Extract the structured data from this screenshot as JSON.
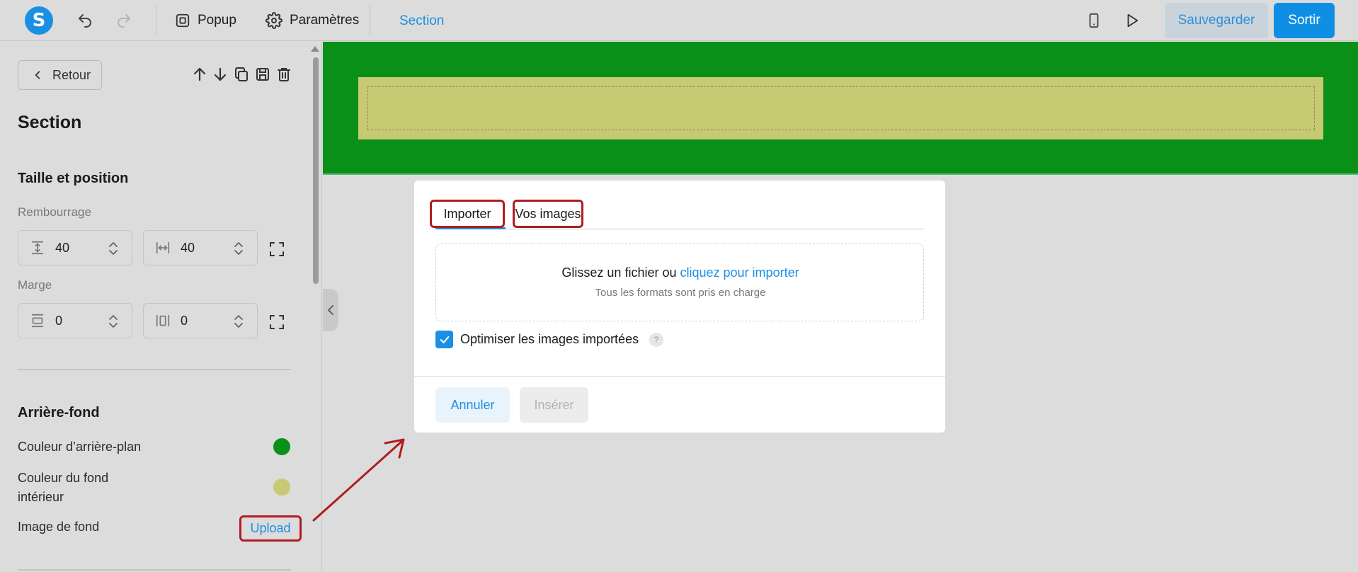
{
  "topbar": {
    "logo_letter": "S",
    "popup_label": "Popup",
    "settings_label": "Paramètres",
    "section_label": "Section",
    "save_label": "Sauvegarder",
    "exit_label": "Sortir",
    "icons": [
      "undo-icon",
      "redo-icon",
      "popup-icon",
      "gear-icon",
      "mobile-icon",
      "play-icon"
    ]
  },
  "sidebar": {
    "back_label": "Retour",
    "title": "Section",
    "size_heading": "Taille et position",
    "padding_label": "Rembourrage",
    "padding_vertical": "40",
    "padding_horizontal": "40",
    "margin_label": "Marge",
    "margin_vertical": "0",
    "margin_horizontal": "0",
    "background_heading": "Arrière-fond",
    "bg_color_label": "Couleur d’arrière-plan",
    "bg_color": "#0a9018",
    "inner_color_label_1": "Couleur du fond",
    "inner_color_label_2": "intérieur",
    "inner_color": "#c8c973",
    "bg_image_label": "Image de fond",
    "upload_label": "Upload"
  },
  "canvas": {
    "section_color": "#0a9018",
    "inner_color": "#c8c973"
  },
  "dialog": {
    "tab_import": "Importer",
    "tab_images": "Vos images",
    "drop_text": "Glissez un fichier ou",
    "drop_link": "cliquez pour importer",
    "drop_sub": "Tous les formats sont pris en charge",
    "optimize_label": "Optimiser les images importées",
    "optimize_checked": true,
    "help_glyph": "?",
    "cancel_label": "Annuler",
    "insert_label": "Insérer"
  },
  "colors": {
    "accent": "#1a8fe3",
    "annotation": "#b01c22"
  }
}
